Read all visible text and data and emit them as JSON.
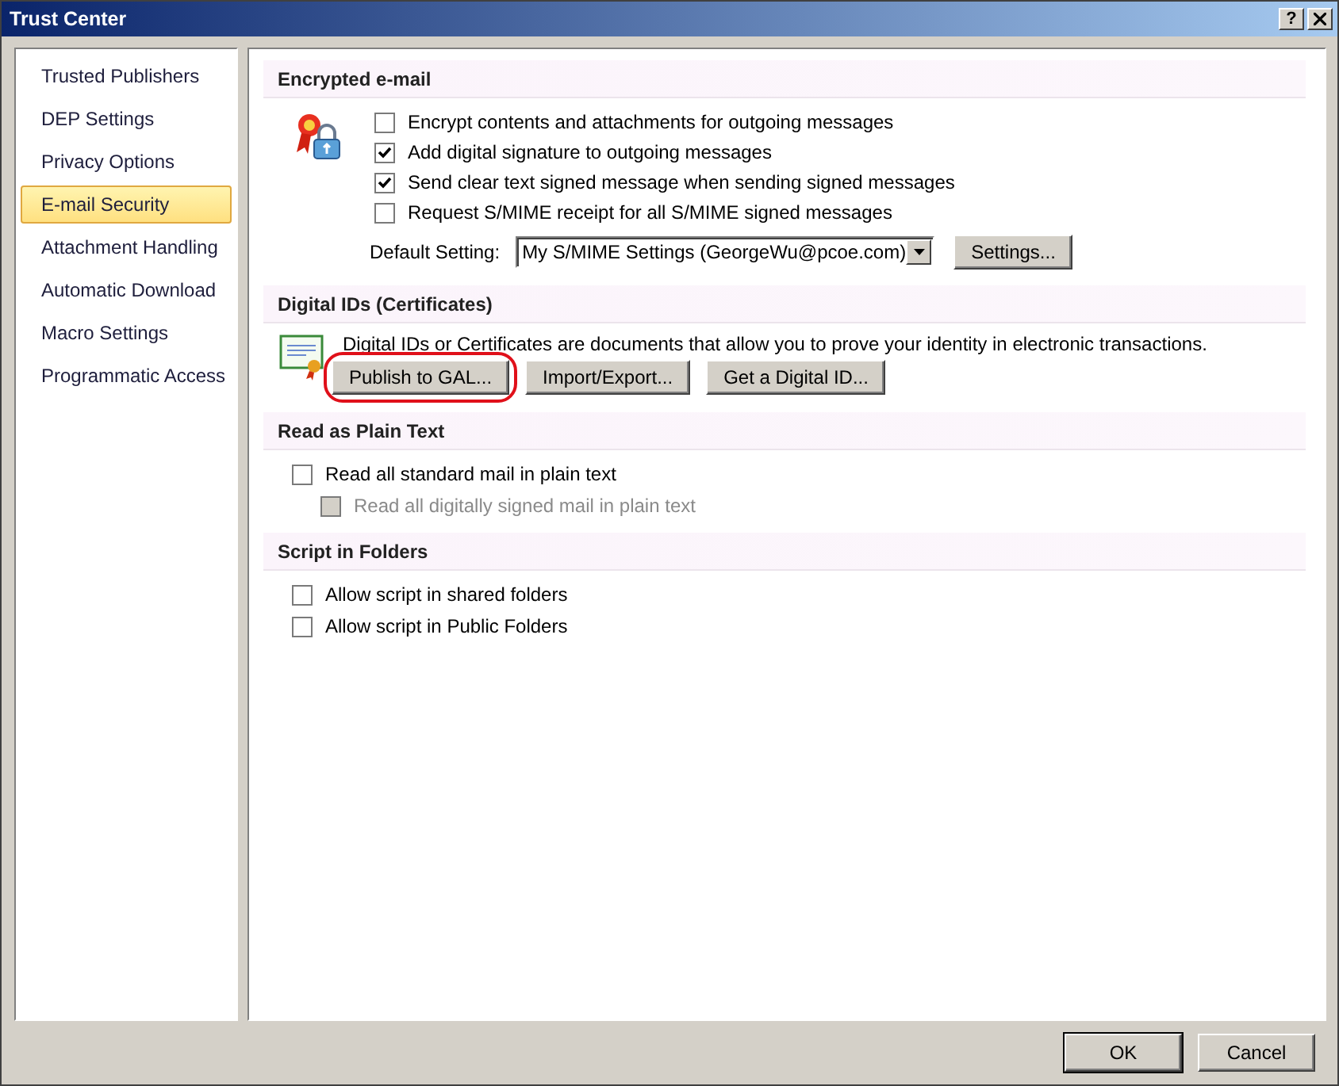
{
  "window": {
    "title": "Trust Center",
    "help": "?"
  },
  "sidebar": {
    "items": [
      {
        "label": "Trusted Publishers",
        "selected": false
      },
      {
        "label": "DEP Settings",
        "selected": false
      },
      {
        "label": "Privacy Options",
        "selected": false
      },
      {
        "label": "E-mail Security",
        "selected": true
      },
      {
        "label": "Attachment Handling",
        "selected": false
      },
      {
        "label": "Automatic Download",
        "selected": false
      },
      {
        "label": "Macro Settings",
        "selected": false
      },
      {
        "label": "Programmatic Access",
        "selected": false
      }
    ]
  },
  "sections": [
    {
      "kind": "encryption",
      "title": "Encrypted e-mail",
      "options": [
        {
          "label": "Encrypt contents and attachments for outgoing messages",
          "checked": false
        },
        {
          "label": "Add digital signature to outgoing messages",
          "checked": true
        },
        {
          "label": "Send clear text signed message when sending signed messages",
          "checked": true
        },
        {
          "label": "Request S/MIME receipt for all S/MIME signed messages",
          "checked": false
        }
      ],
      "default_setting": {
        "label": "Default Setting:",
        "value": "My S/MIME Settings (GeorgeWu@pcoe.com)"
      },
      "settings_button": "Settings..."
    },
    {
      "kind": "ids",
      "title": "Digital IDs (Certificates)",
      "description": "Digital IDs or Certificates are documents that allow you to prove your identity in electronic transactions.",
      "buttons": [
        {
          "label": "Publish to GAL...",
          "highlighted": true
        },
        {
          "label": "Import/Export...",
          "highlighted": false
        },
        {
          "label": "Get a Digital ID...",
          "highlighted": false
        }
      ]
    },
    {
      "kind": "options",
      "title": "Read as Plain Text",
      "options": [
        {
          "label": "Read all standard mail in plain text",
          "checked": false,
          "disabled": false,
          "children": [
            {
              "label": "Read all digitally signed mail in plain text",
              "checked": false,
              "disabled": true
            }
          ]
        }
      ]
    },
    {
      "kind": "options",
      "title": "Script in Folders",
      "options": [
        {
          "label": "Allow script in shared folders",
          "checked": false,
          "disabled": false
        },
        {
          "label": "Allow script in Public Folders",
          "checked": false,
          "disabled": false
        }
      ]
    }
  ],
  "footer": {
    "buttons": [
      "OK",
      "Cancel"
    ]
  }
}
